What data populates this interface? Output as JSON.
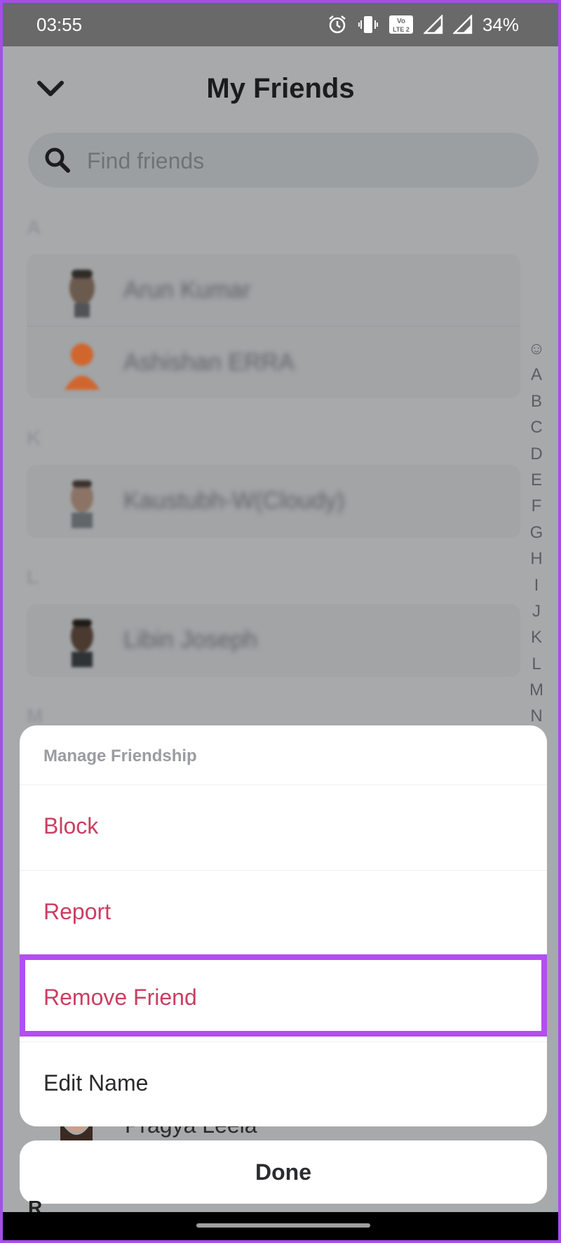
{
  "status_bar": {
    "time": "03:55",
    "battery": "34%",
    "icons": [
      "alarm-icon",
      "vibrate-icon",
      "volte-icon",
      "signal-icon",
      "signal-icon"
    ],
    "volte_label": "Vo LTE 2"
  },
  "header": {
    "title": "My Friends",
    "back_icon": "chevron-down-icon"
  },
  "search": {
    "placeholder": "Find friends",
    "icon": "search-icon"
  },
  "sections": [
    {
      "letter": "A",
      "friends": [
        {
          "name": "Arun Kumar"
        },
        {
          "name": "Ashishan ERRA"
        }
      ]
    },
    {
      "letter": "K",
      "friends": [
        {
          "name": "Kaustubh-W(Cloudy)"
        }
      ]
    },
    {
      "letter": "L",
      "friends": [
        {
          "name": "Libin Joseph"
        }
      ]
    },
    {
      "letter": "M",
      "friends": []
    }
  ],
  "alphabet_index": [
    "☺",
    "A",
    "B",
    "C",
    "D",
    "E",
    "F",
    "G",
    "H",
    "I",
    "J",
    "K",
    "L",
    "M",
    "N"
  ],
  "action_sheet": {
    "title": "Manage Friendship",
    "items": [
      {
        "label": "Block"
      },
      {
        "label": "Report"
      },
      {
        "label": "Remove Friend"
      },
      {
        "label": "Edit Name"
      }
    ]
  },
  "peek_row": {
    "name": "Pragya Leela"
  },
  "done_label": "Done",
  "peek_section_letter": "R",
  "colors": {
    "danger": "#cb3e61",
    "highlight": "#b24ff0",
    "frame": "#a64ee8"
  }
}
